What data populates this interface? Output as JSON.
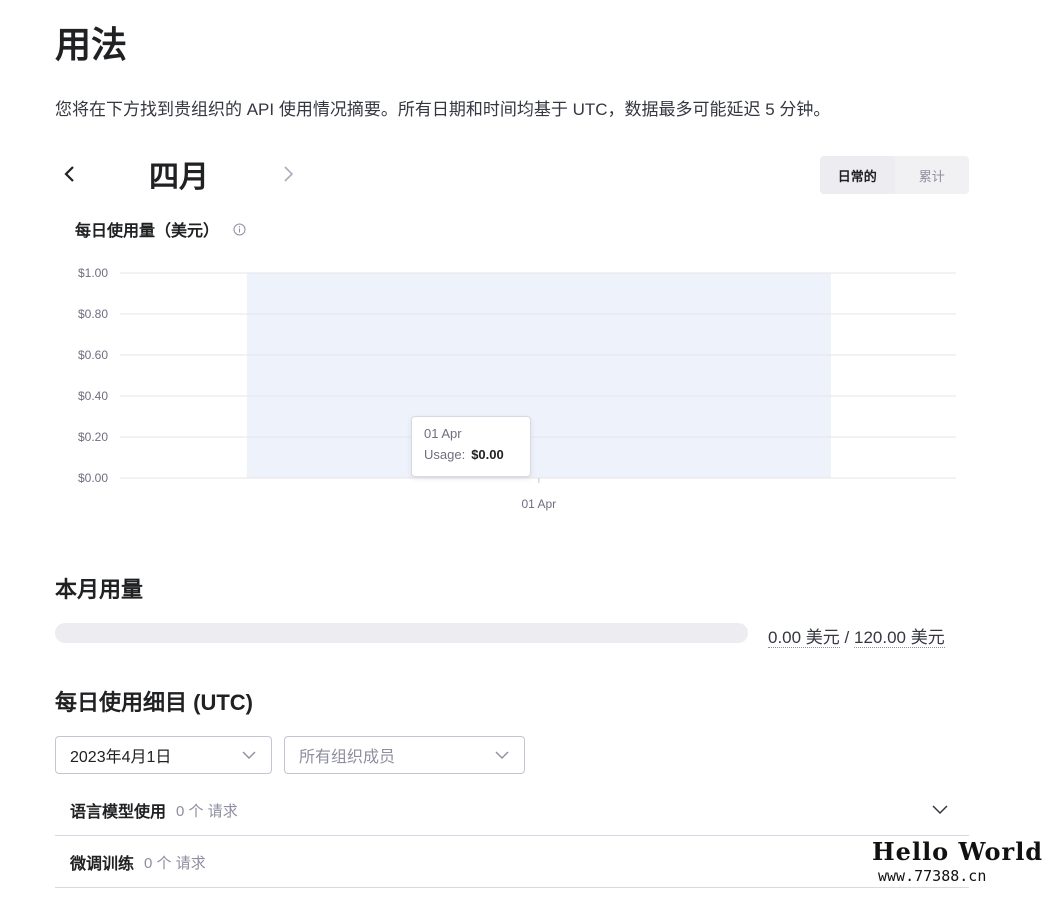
{
  "page": {
    "title": "用法",
    "intro": "您将在下方找到贵组织的 API 使用情况摘要。所有日期和时间均基于 UTC，数据最多可能延迟 5 分钟。"
  },
  "month_nav": {
    "month": "四月",
    "prev_icon": "chevron-left-icon",
    "next_icon": "chevron-right-icon"
  },
  "view_toggle": {
    "daily_label": "日常的",
    "cumulative_label": "累计",
    "selected": "日常的"
  },
  "chart_section": {
    "title": "每日使用量（美元）",
    "info_icon": "info-icon"
  },
  "chart_data": {
    "type": "bar",
    "title": "每日使用量（美元）",
    "categories": [
      "01 Apr"
    ],
    "values": [
      0.0
    ],
    "y_tick_labels": [
      "$0.00",
      "$0.20",
      "$0.40",
      "$0.60",
      "$0.80",
      "$1.00"
    ],
    "y_ticks": [
      0,
      0.2,
      0.4,
      0.6,
      0.8,
      1.0
    ],
    "ylim": [
      0,
      1.0
    ],
    "x_tick_labels": [
      "01 Apr"
    ],
    "grid": true,
    "hover_band_color": "#eef2fa",
    "tooltip": {
      "date": "01 Apr",
      "label": "Usage:",
      "value": "$0.00"
    }
  },
  "monthly_usage": {
    "heading": "本月用量",
    "used_text": "0.00 美元",
    "separator": "/",
    "limit_text": "120.00 美元",
    "used_fraction": 0.0,
    "fill_color": "#10a37f"
  },
  "daily_breakdown": {
    "heading": "每日使用细目 (UTC)",
    "date_select": {
      "value": "2023年4月1日"
    },
    "member_select": {
      "placeholder": "所有组织成员"
    },
    "rows": [
      {
        "title": "语言模型使用",
        "count": "0 个 请求"
      },
      {
        "title": "微调训练",
        "count": "0 个 请求"
      }
    ]
  },
  "watermark": {
    "line1": "Hello World",
    "line2": "www.77388.cn"
  },
  "colors": {
    "text_primary": "#202123",
    "text_muted": "#8e8ea0",
    "grid": "#e5e5ea",
    "track": "#ececf1"
  }
}
